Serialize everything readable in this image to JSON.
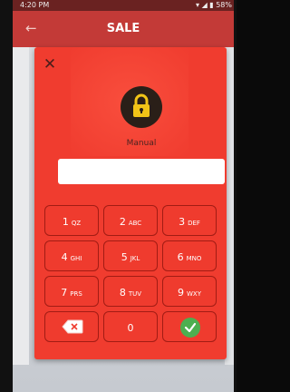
{
  "status_bar": {
    "time": "4:20 PM",
    "right_info": "▾ ◢ ▮ 58%"
  },
  "app_bar": {
    "title": "SALE",
    "back_icon": "arrow-left-icon"
  },
  "dialog": {
    "close_icon": "close-icon",
    "lock_icon": "padlock-icon",
    "mode_label": "Manual",
    "pin_value": "",
    "accent_color": "#f03c2f",
    "lock_color": "#f2c417",
    "ok_color": "#4caf50"
  },
  "keypad": {
    "rows": [
      [
        {
          "digit": "1",
          "letters": "QZ"
        },
        {
          "digit": "2",
          "letters": "ABC"
        },
        {
          "digit": "3",
          "letters": "DEF"
        }
      ],
      [
        {
          "digit": "4",
          "letters": "GHI"
        },
        {
          "digit": "5",
          "letters": "JKL"
        },
        {
          "digit": "6",
          "letters": "MNO"
        }
      ],
      [
        {
          "digit": "7",
          "letters": "PRS"
        },
        {
          "digit": "8",
          "letters": "TUV"
        },
        {
          "digit": "9",
          "letters": "WXY"
        }
      ]
    ],
    "bottom": {
      "delete_icon": "backspace-icon",
      "zero": "0",
      "ok_icon": "check-icon"
    }
  }
}
